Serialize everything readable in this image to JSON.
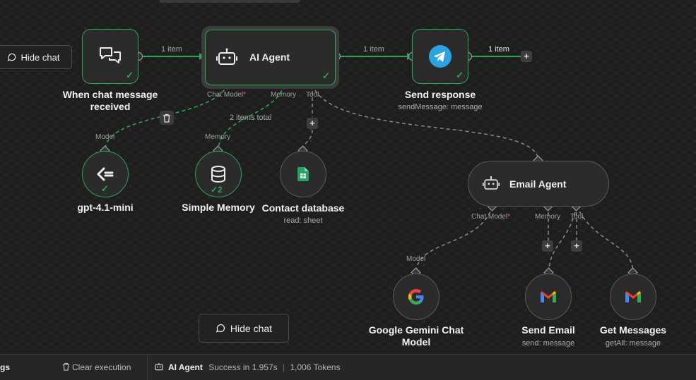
{
  "canvas": {
    "hide_chat_top": "Hide chat",
    "hide_chat_bottom": "Hide chat"
  },
  "nodes": {
    "trigger": {
      "title": "When chat message received"
    },
    "ai_agent": {
      "title": "AI Agent",
      "ports": {
        "chat_model": "Chat Model",
        "memory": "Memory",
        "tool": "Tool"
      }
    },
    "send_response": {
      "title": "Send response",
      "subtitle": "sendMessage: message"
    },
    "gpt": {
      "title": "gpt-4.1-mini",
      "port": "Model"
    },
    "memory": {
      "title": "Simple Memory",
      "port": "Memory",
      "runs": "2"
    },
    "contact_db": {
      "title": "Contact database",
      "subtitle": "read: sheet"
    },
    "email_agent": {
      "title": "Email Agent",
      "ports": {
        "chat_model": "Chat Model",
        "memory": "Memory",
        "tool": "Tool"
      }
    },
    "gemini": {
      "title": "Google Gemini Chat Model",
      "port": "Model"
    },
    "send_email": {
      "title": "Send Email",
      "subtitle": "send: message"
    },
    "get_messages": {
      "title": "Get Messages",
      "subtitle": "getAll: message"
    }
  },
  "edges": {
    "trigger_to_agent": "1 item",
    "agent_to_send": "1 item",
    "send_out": "1 item",
    "memory_items": "2 items total"
  },
  "required_marker": "*",
  "bottom_bar": {
    "left_fragment": "gs",
    "clear_execution": "Clear execution",
    "node_name": "AI Agent",
    "status": "Success in 1.957s",
    "tokens": "1,006 Tokens"
  },
  "colors": {
    "success_green": "#2fa35a",
    "canvas_bg": "#1f1f1f",
    "node_bg": "#2b2b2b",
    "telegram_blue": "#2aa3e0",
    "sheets_green": "#21a464"
  },
  "icons": {
    "trigger": "chat-bubbles-icon",
    "ai_agent": "robot-icon",
    "send_response": "telegram-icon",
    "gpt": "openai-icon",
    "memory": "database-icon",
    "contact_db": "google-sheets-icon",
    "email_agent": "robot-icon",
    "gemini": "google-icon",
    "send_email": "gmail-icon",
    "get_messages": "gmail-icon"
  }
}
